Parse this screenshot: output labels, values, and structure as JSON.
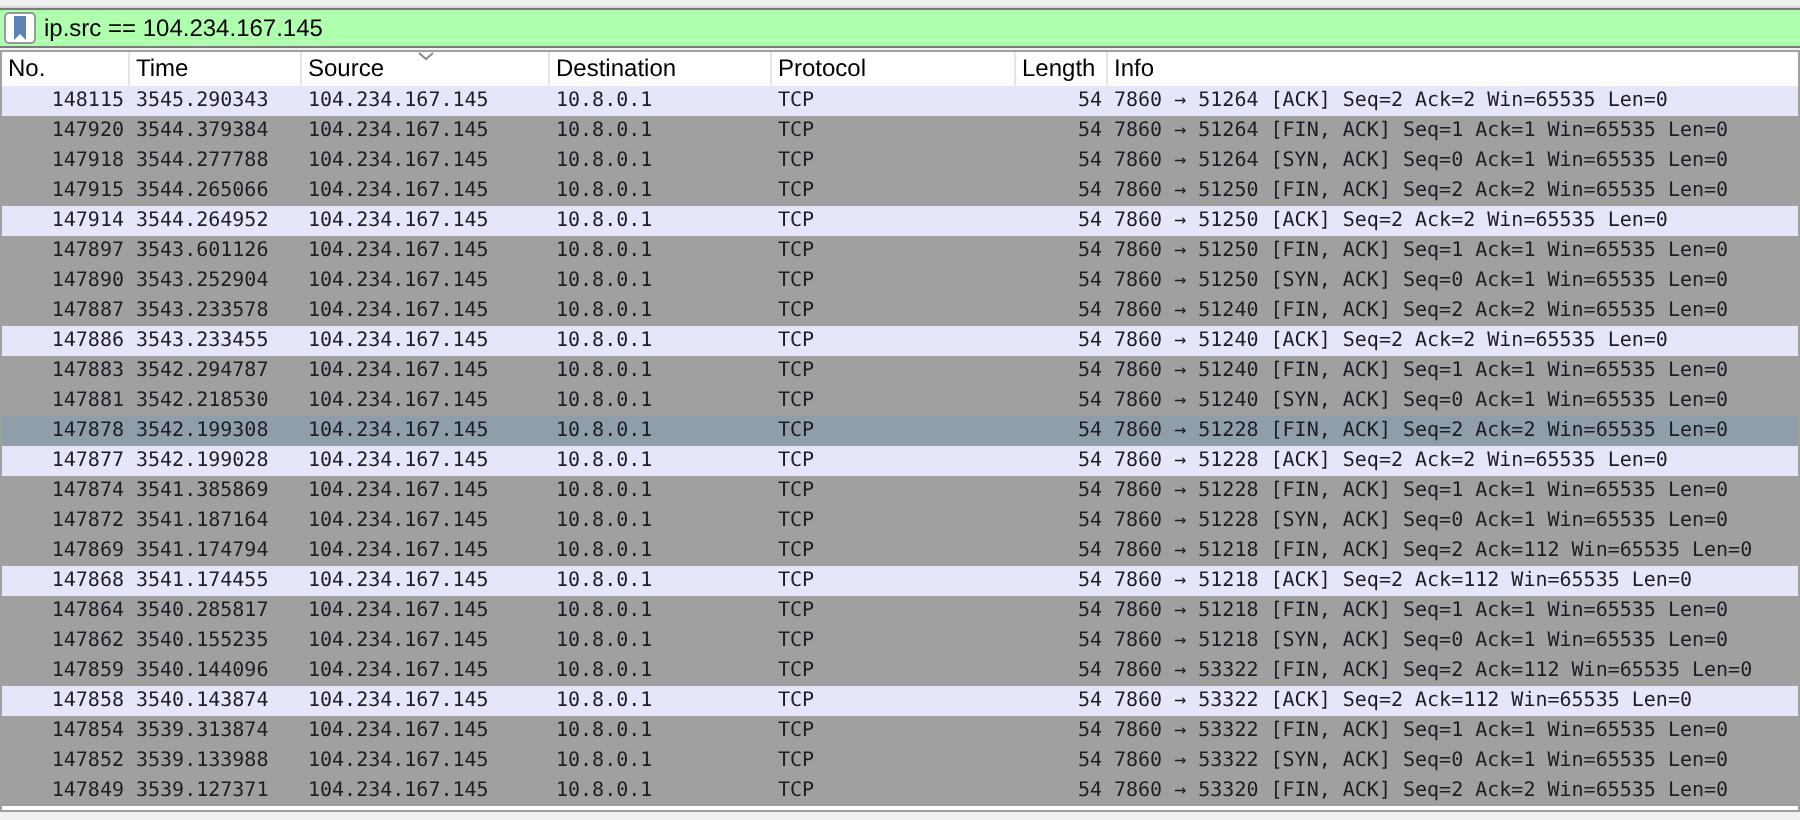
{
  "filter": {
    "value": "ip.src == 104.234.167.145"
  },
  "table": {
    "columns": [
      {
        "label": "No.",
        "sorted": false
      },
      {
        "label": "Time",
        "sorted": false
      },
      {
        "label": "Source",
        "sorted": true
      },
      {
        "label": "Destination",
        "sorted": false
      },
      {
        "label": "Protocol",
        "sorted": false
      },
      {
        "label": "Length",
        "sorted": false
      },
      {
        "label": "Info",
        "sorted": false
      }
    ],
    "rows": [
      {
        "color": "#e6e6fa",
        "cells": [
          "148115",
          "3545.290343",
          "104.234.167.145",
          "10.8.0.1",
          "TCP",
          "54",
          "7860 → 51264 [ACK] Seq=2 Ack=2 Win=65535 Len=0"
        ]
      },
      {
        "color": "#a0a0a0",
        "cells": [
          "147920",
          "3544.379384",
          "104.234.167.145",
          "10.8.0.1",
          "TCP",
          "54",
          "7860 → 51264 [FIN, ACK] Seq=1 Ack=1 Win=65535 Len=0"
        ]
      },
      {
        "color": "#a0a0a0",
        "cells": [
          "147918",
          "3544.277788",
          "104.234.167.145",
          "10.8.0.1",
          "TCP",
          "54",
          "7860 → 51264 [SYN, ACK] Seq=0 Ack=1 Win=65535 Len=0"
        ]
      },
      {
        "color": "#a0a0a0",
        "cells": [
          "147915",
          "3544.265066",
          "104.234.167.145",
          "10.8.0.1",
          "TCP",
          "54",
          "7860 → 51250 [FIN, ACK] Seq=2 Ack=2 Win=65535 Len=0"
        ]
      },
      {
        "color": "#e6e6fa",
        "cells": [
          "147914",
          "3544.264952",
          "104.234.167.145",
          "10.8.0.1",
          "TCP",
          "54",
          "7860 → 51250 [ACK] Seq=2 Ack=2 Win=65535 Len=0"
        ]
      },
      {
        "color": "#a0a0a0",
        "cells": [
          "147897",
          "3543.601126",
          "104.234.167.145",
          "10.8.0.1",
          "TCP",
          "54",
          "7860 → 51250 [FIN, ACK] Seq=1 Ack=1 Win=65535 Len=0"
        ]
      },
      {
        "color": "#a0a0a0",
        "cells": [
          "147890",
          "3543.252904",
          "104.234.167.145",
          "10.8.0.1",
          "TCP",
          "54",
          "7860 → 51250 [SYN, ACK] Seq=0 Ack=1 Win=65535 Len=0"
        ]
      },
      {
        "color": "#a0a0a0",
        "cells": [
          "147887",
          "3543.233578",
          "104.234.167.145",
          "10.8.0.1",
          "TCP",
          "54",
          "7860 → 51240 [FIN, ACK] Seq=2 Ack=2 Win=65535 Len=0"
        ]
      },
      {
        "color": "#e6e6fa",
        "cells": [
          "147886",
          "3543.233455",
          "104.234.167.145",
          "10.8.0.1",
          "TCP",
          "54",
          "7860 → 51240 [ACK] Seq=2 Ack=2 Win=65535 Len=0"
        ]
      },
      {
        "color": "#a0a0a0",
        "cells": [
          "147883",
          "3542.294787",
          "104.234.167.145",
          "10.8.0.1",
          "TCP",
          "54",
          "7860 → 51240 [FIN, ACK] Seq=1 Ack=1 Win=65535 Len=0"
        ]
      },
      {
        "color": "#a0a0a0",
        "cells": [
          "147881",
          "3542.218530",
          "104.234.167.145",
          "10.8.0.1",
          "TCP",
          "54",
          "7860 → 51240 [SYN, ACK] Seq=0 Ack=1 Win=65535 Len=0"
        ]
      },
      {
        "color": "#8f9ea8",
        "cells": [
          "147878",
          "3542.199308",
          "104.234.167.145",
          "10.8.0.1",
          "TCP",
          "54",
          "7860 → 51228 [FIN, ACK] Seq=2 Ack=2 Win=65535 Len=0"
        ]
      },
      {
        "color": "#e6e6fa",
        "cells": [
          "147877",
          "3542.199028",
          "104.234.167.145",
          "10.8.0.1",
          "TCP",
          "54",
          "7860 → 51228 [ACK] Seq=2 Ack=2 Win=65535 Len=0"
        ]
      },
      {
        "color": "#a0a0a0",
        "cells": [
          "147874",
          "3541.385869",
          "104.234.167.145",
          "10.8.0.1",
          "TCP",
          "54",
          "7860 → 51228 [FIN, ACK] Seq=1 Ack=1 Win=65535 Len=0"
        ]
      },
      {
        "color": "#a0a0a0",
        "cells": [
          "147872",
          "3541.187164",
          "104.234.167.145",
          "10.8.0.1",
          "TCP",
          "54",
          "7860 → 51228 [SYN, ACK] Seq=0 Ack=1 Win=65535 Len=0"
        ]
      },
      {
        "color": "#a0a0a0",
        "cells": [
          "147869",
          "3541.174794",
          "104.234.167.145",
          "10.8.0.1",
          "TCP",
          "54",
          "7860 → 51218 [FIN, ACK] Seq=2 Ack=112 Win=65535 Len=0"
        ]
      },
      {
        "color": "#e6e6fa",
        "cells": [
          "147868",
          "3541.174455",
          "104.234.167.145",
          "10.8.0.1",
          "TCP",
          "54",
          "7860 → 51218 [ACK] Seq=2 Ack=112 Win=65535 Len=0"
        ]
      },
      {
        "color": "#a0a0a0",
        "cells": [
          "147864",
          "3540.285817",
          "104.234.167.145",
          "10.8.0.1",
          "TCP",
          "54",
          "7860 → 51218 [FIN, ACK] Seq=1 Ack=1 Win=65535 Len=0"
        ]
      },
      {
        "color": "#a0a0a0",
        "cells": [
          "147862",
          "3540.155235",
          "104.234.167.145",
          "10.8.0.1",
          "TCP",
          "54",
          "7860 → 51218 [SYN, ACK] Seq=0 Ack=1 Win=65535 Len=0"
        ]
      },
      {
        "color": "#a0a0a0",
        "cells": [
          "147859",
          "3540.144096",
          "104.234.167.145",
          "10.8.0.1",
          "TCP",
          "54",
          "7860 → 53322 [FIN, ACK] Seq=2 Ack=112 Win=65535 Len=0"
        ]
      },
      {
        "color": "#e6e6fa",
        "cells": [
          "147858",
          "3540.143874",
          "104.234.167.145",
          "10.8.0.1",
          "TCP",
          "54",
          "7860 → 53322 [ACK] Seq=2 Ack=112 Win=65535 Len=0"
        ]
      },
      {
        "color": "#a0a0a0",
        "cells": [
          "147854",
          "3539.313874",
          "104.234.167.145",
          "10.8.0.1",
          "TCP",
          "54",
          "7860 → 53322 [FIN, ACK] Seq=1 Ack=1 Win=65535 Len=0"
        ]
      },
      {
        "color": "#a0a0a0",
        "cells": [
          "147852",
          "3539.133988",
          "104.234.167.145",
          "10.8.0.1",
          "TCP",
          "54",
          "7860 → 53322 [SYN, ACK] Seq=0 Ack=1 Win=65535 Len=0"
        ]
      },
      {
        "color": "#a0a0a0",
        "cells": [
          "147849",
          "3539.127371",
          "104.234.167.145",
          "10.8.0.1",
          "TCP",
          "54",
          "7860 → 53320 [FIN, ACK] Seq=2 Ack=2 Win=65535 Len=0"
        ]
      }
    ]
  }
}
